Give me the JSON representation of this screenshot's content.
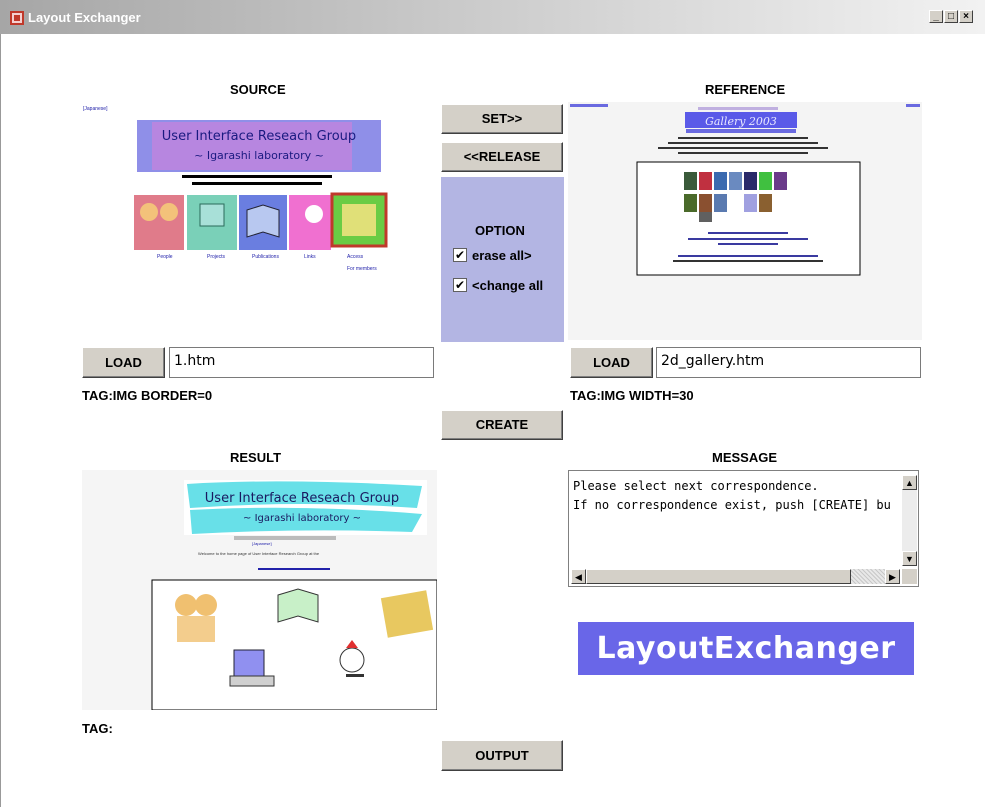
{
  "window": {
    "title": "Layout Exchanger",
    "minimize": "_",
    "maximize": "□",
    "close": "×"
  },
  "source": {
    "heading": "SOURCE",
    "load_label": "LOAD",
    "filename": "1.htm",
    "tag": "TAG:IMG BORDER=0",
    "preview": {
      "banner_line1": "User Interface Reseach Group",
      "banner_line2": "~ Igarashi laboratory ~",
      "lang_link": "[Japanese]",
      "welcome": "Welcome to the home page of User Interface Research Group at the Computer Science Department, The University of Tokyo.",
      "links": [
        "People",
        "Projects",
        "Publications",
        "Links",
        "Access"
      ],
      "extra_link": "For members"
    }
  },
  "reference": {
    "heading": "REFERENCE",
    "load_label": "LOAD",
    "filename": "2d_gallery.htm",
    "tag": "TAG:IMG WIDTH=30",
    "preview": {
      "gallery_title": "Gallery 2003"
    }
  },
  "middle": {
    "set_label": "SET>>",
    "release_label": "<<RELEASE",
    "option_heading": "OPTION",
    "option1": "erase all>",
    "option2": "<change all",
    "create_label": "CREATE",
    "output_label": "OUTPUT"
  },
  "result": {
    "heading": "RESULT",
    "tag": "TAG:",
    "preview": {
      "banner_line1": "User Interface Reseach Group",
      "banner_line2": "~ Igarashi laboratory ~",
      "lang_link": "[Japanese]",
      "welcome": "Welcome to the home page of User Interface Research Group at the"
    }
  },
  "message": {
    "heading": "MESSAGE",
    "line1": "Please select next correspondence.",
    "line2": "If no correspondence exist, push [CREATE] bu"
  },
  "logo": {
    "text": "LayoutExchanger"
  },
  "colors": {
    "option_bg": "#b3b5e3",
    "logo_bg": "#6966e8"
  }
}
